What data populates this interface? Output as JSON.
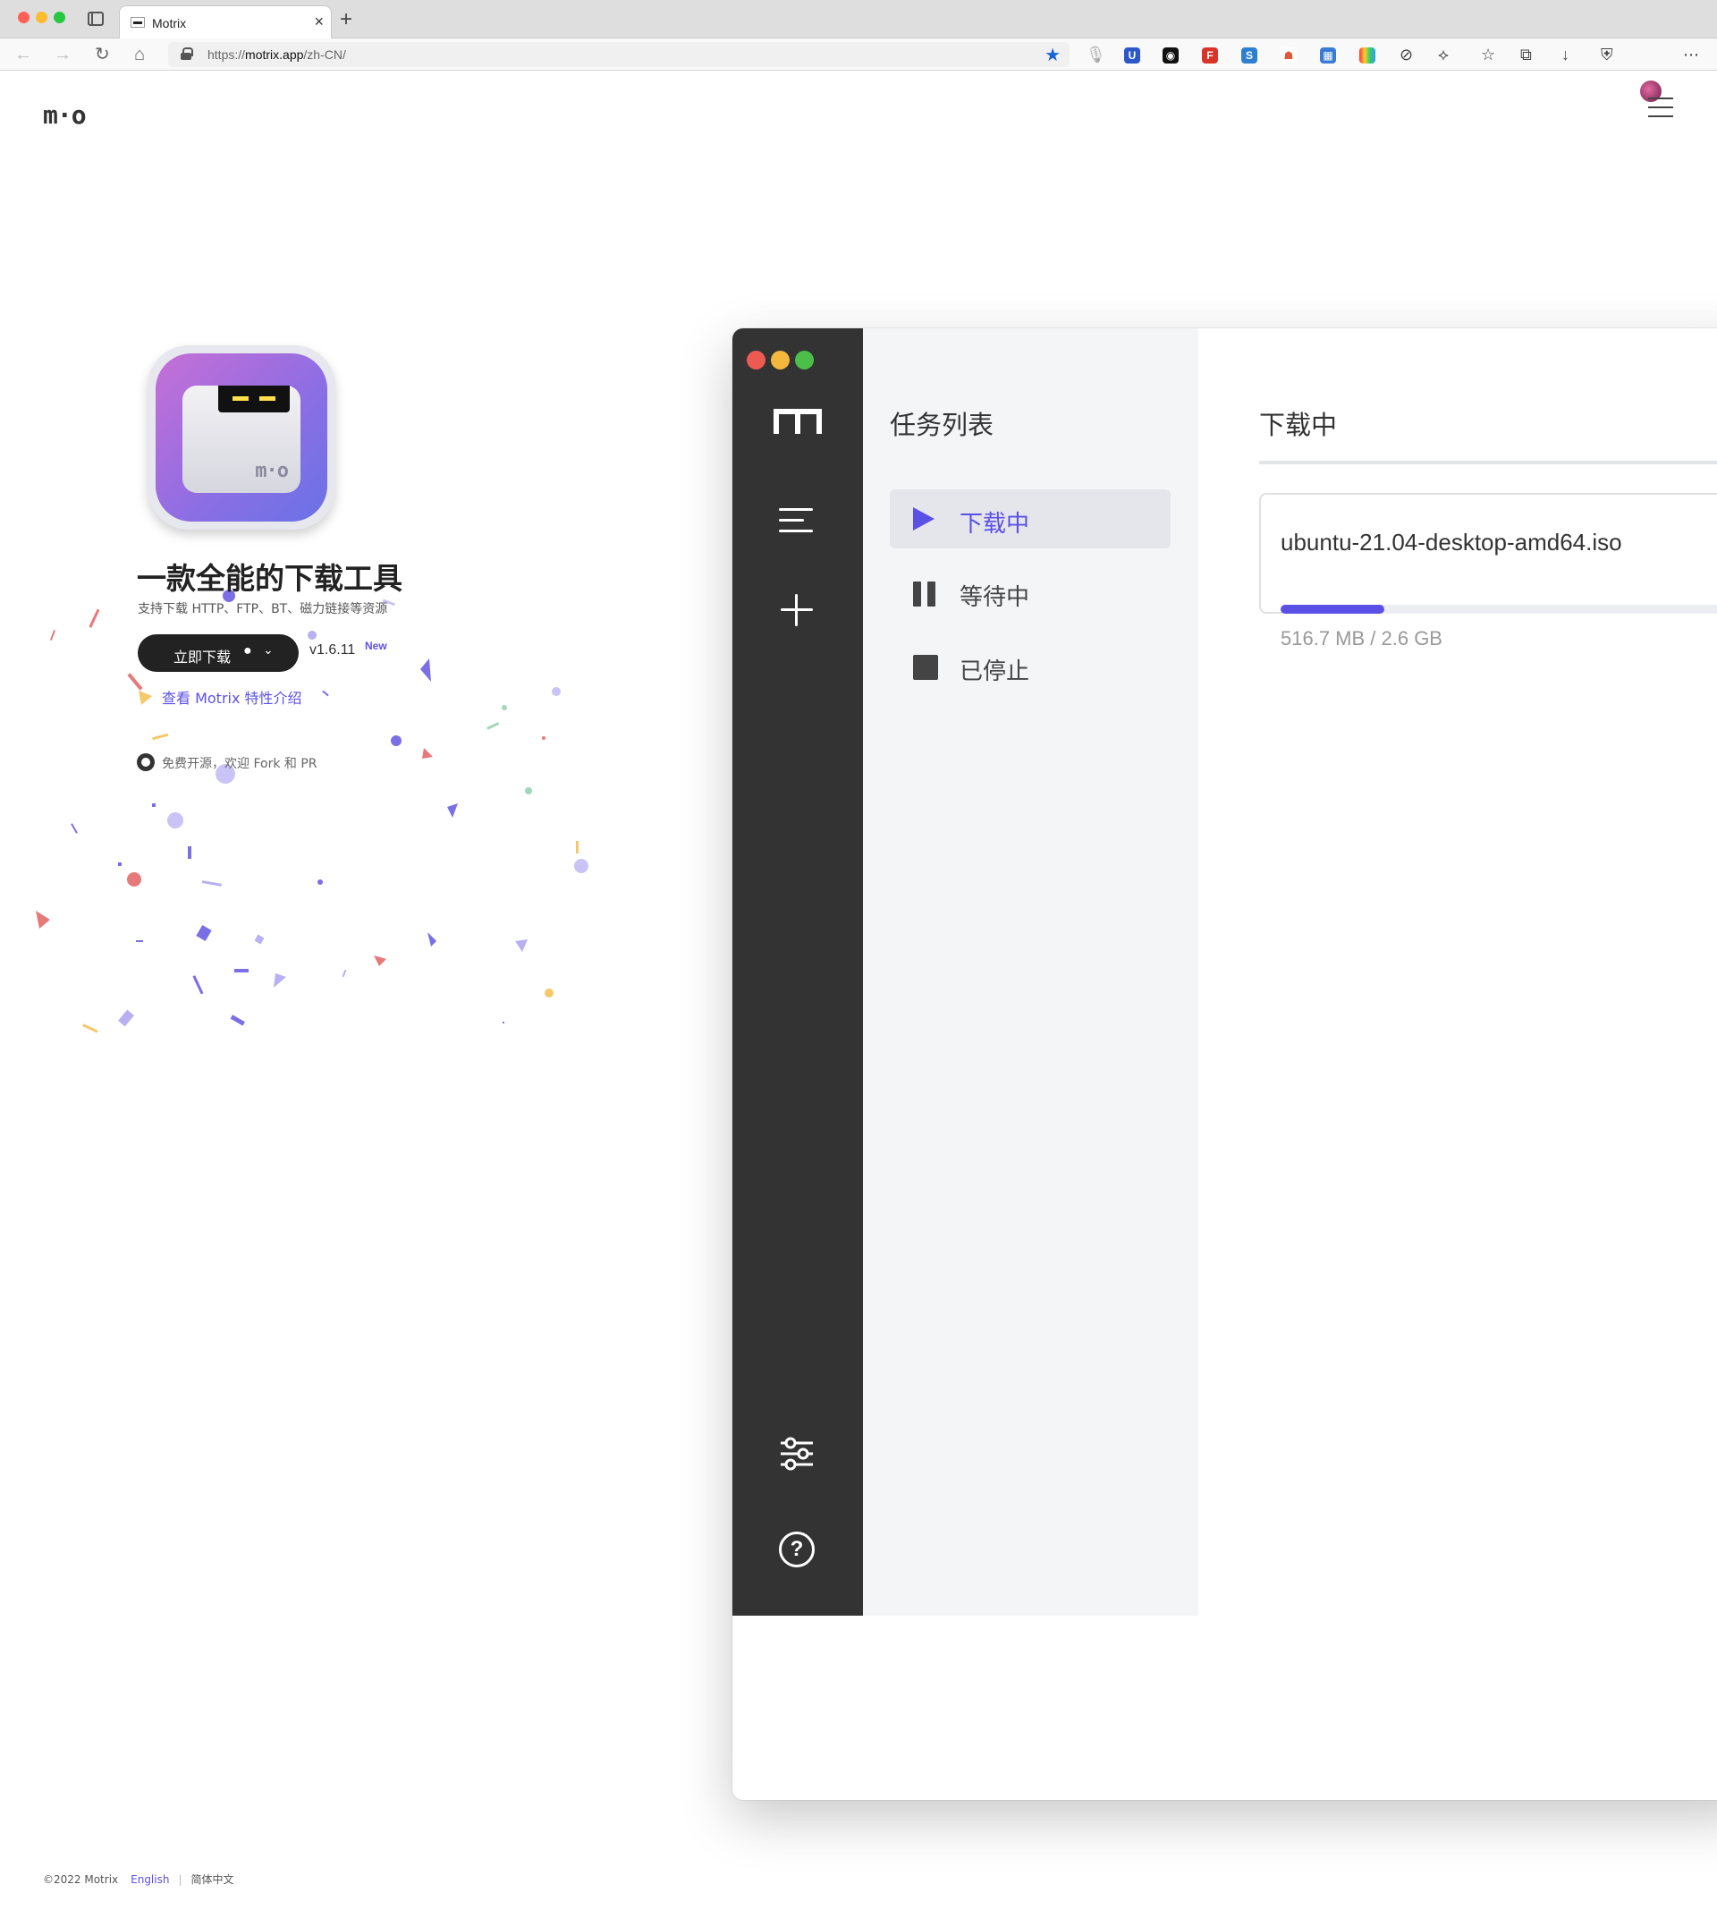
{
  "browser": {
    "tab_title": "Motrix",
    "url_prefix": "https://",
    "url_host": "motrix.app",
    "url_path": "/zh-CN/",
    "traffic_colors": [
      "#ff5f57",
      "#febc2e",
      "#28c840"
    ]
  },
  "site": {
    "logo": "m·o",
    "hero_title": "一款全能的下载工具",
    "hero_subtitle": "支持下载 HTTP、FTP、BT、磁力链接等资源",
    "download_button": "立即下载",
    "version": "v1.6.11",
    "new_badge": "New",
    "features_link": "查看 Motrix 特性介绍",
    "github_text": "免费开源，欢迎 Fork 和 PR",
    "accent_color": "#5b50e6"
  },
  "app_window": {
    "traffic_colors": [
      "#ee5a52",
      "#f4b83c",
      "#4cbf4a"
    ],
    "panel_title": "任务列表",
    "nav": [
      {
        "label": "下载中",
        "icon": "play-icon",
        "active": true
      },
      {
        "label": "等待中",
        "icon": "pause-icon",
        "active": false
      },
      {
        "label": "已停止",
        "icon": "stop-icon",
        "active": false
      }
    ],
    "main_title": "下载中",
    "task": {
      "name": "ubuntu-21.04-desktop-amd64.iso",
      "size": "516.7 MB / 2.6 GB",
      "progress": 0.194
    }
  },
  "footer": {
    "copyright": "©2022 Motrix",
    "lang_en": "English",
    "lang_zh": "简体中文"
  }
}
